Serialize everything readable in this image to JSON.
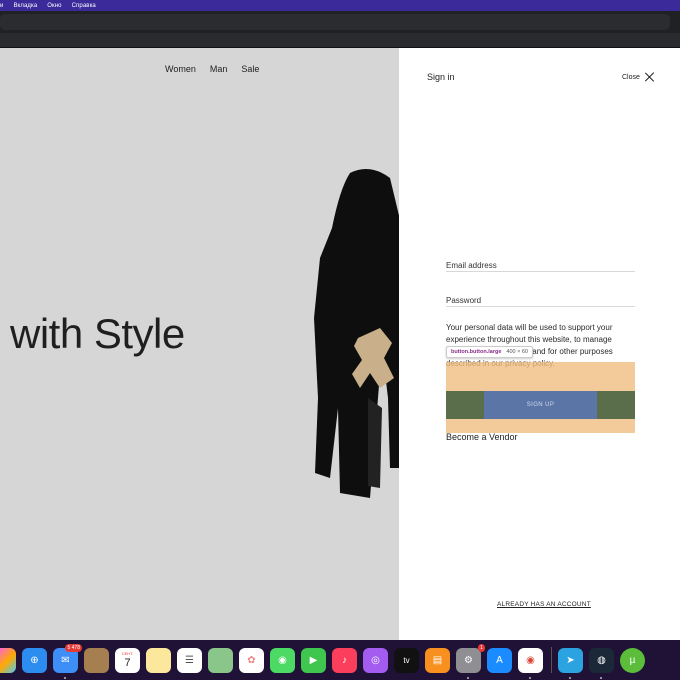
{
  "menubar": {
    "items": [
      "и",
      "Вкладка",
      "Окно",
      "Справка"
    ]
  },
  "site": {
    "nav": [
      "Women",
      "Man",
      "Sale"
    ],
    "hero_text": "with Style"
  },
  "drawer": {
    "title": "Sign in",
    "close_label": "Close",
    "email_placeholder": "Email address",
    "password_placeholder": "Password",
    "privacy_text_1": "Your personal data will be used to support your experience throughout this website, to manage",
    "privacy_text_2": "access to your account, and for other purposes",
    "privacy_text_3": "described in our",
    "privacy_link": "privacy policy.",
    "signup_label": "SIGN UP",
    "vendor_label": "Become a Vendor",
    "already_label": "ALREADY HAS AN ACCOUNT"
  },
  "devtools_tooltip": {
    "selector": "button.button.large",
    "size": "400 × 60"
  },
  "dock": {
    "mail_badge": "5 478",
    "calendar_month": "СЕНТ.",
    "calendar_day": "7",
    "settings_badge": "1",
    "appletv_label": "tv"
  },
  "colors": {
    "menubar": "#3a2a9a",
    "signup": "#5b76a6",
    "highlight": "#f0be82"
  }
}
